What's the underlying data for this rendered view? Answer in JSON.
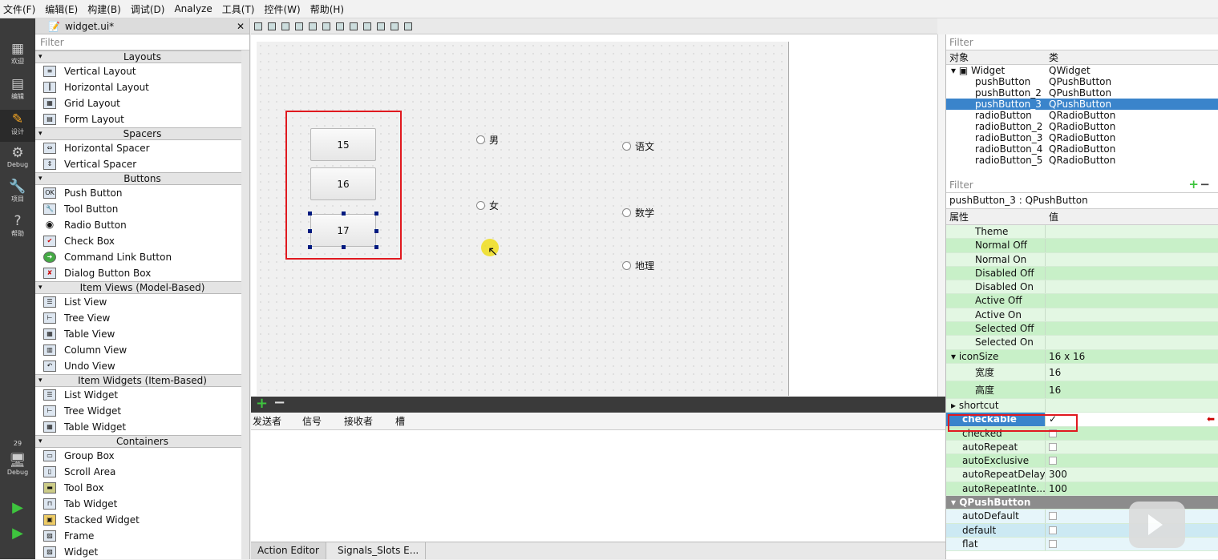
{
  "menu": [
    "文件(F)",
    "编辑(E)",
    "构建(B)",
    "调试(D)",
    "Analyze",
    "工具(T)",
    "控件(W)",
    "帮助(H)"
  ],
  "modes": [
    {
      "label": "欢迎",
      "icon": "▦"
    },
    {
      "label": "编辑",
      "icon": "▤"
    },
    {
      "label": "设计",
      "icon": "✎"
    },
    {
      "label": "Debug",
      "icon": "⚙"
    },
    {
      "label": "项目",
      "icon": "🔧"
    },
    {
      "label": "帮助",
      "icon": "?"
    },
    {
      "label": "29",
      "icon": ""
    },
    {
      "label": "Debug",
      "icon": "🖥"
    }
  ],
  "file_tab": "widget.ui*",
  "widgetbox": {
    "filter_placeholder": "Filter",
    "categories": {
      "layouts": "Layouts",
      "spacers": "Spacers",
      "buttons": "Buttons",
      "item_views": "Item Views (Model-Based)",
      "item_widgets": "Item Widgets (Item-Based)",
      "containers": "Containers"
    },
    "items": {
      "vlayout": "Vertical Layout",
      "hlayout": "Horizontal Layout",
      "grid": "Grid Layout",
      "form": "Form Layout",
      "hspacer": "Horizontal Spacer",
      "vspacer": "Vertical Spacer",
      "push": "Push Button",
      "tool": "Tool Button",
      "radio": "Radio Button",
      "check": "Check Box",
      "cmdlink": "Command Link Button",
      "dialogbox": "Dialog Button Box",
      "listview": "List View",
      "treeview": "Tree View",
      "tableview": "Table View",
      "columnview": "Column View",
      "undoview": "Undo View",
      "listwidget": "List Widget",
      "treewidget": "Tree Widget",
      "tablewidget": "Table Widget",
      "groupbox": "Group Box",
      "scrollarea": "Scroll Area",
      "toolbox": "Tool Box",
      "tabwidget": "Tab Widget",
      "stacked": "Stacked Widget",
      "frame": "Frame",
      "widget": "Widget"
    }
  },
  "form": {
    "buttons": [
      "15",
      "16",
      "17"
    ],
    "radios": {
      "male": "男",
      "female": "女",
      "chinese": "语文",
      "math": "数学",
      "geo": "地理"
    }
  },
  "signals": {
    "headers": [
      "发送者",
      "信号",
      "接收者",
      "槽"
    ]
  },
  "bottom_tabs": [
    "Action Editor",
    "Signals_Slots E..."
  ],
  "objects": {
    "filter_placeholder": "Filter",
    "headers": [
      "对象",
      "类"
    ],
    "root": {
      "name": "Widget",
      "cls": "QWidget"
    },
    "rows": [
      {
        "name": "pushButton",
        "cls": "QPushButton"
      },
      {
        "name": "pushButton_2",
        "cls": "QPushButton"
      },
      {
        "name": "pushButton_3",
        "cls": "QPushButton"
      },
      {
        "name": "radioButton",
        "cls": "QRadioButton"
      },
      {
        "name": "radioButton_2",
        "cls": "QRadioButton"
      },
      {
        "name": "radioButton_3",
        "cls": "QRadioButton"
      },
      {
        "name": "radioButton_4",
        "cls": "QRadioButton"
      },
      {
        "name": "radioButton_5",
        "cls": "QRadioButton"
      }
    ]
  },
  "props": {
    "filter_placeholder": "Filter",
    "title": "pushButton_3 : QPushButton",
    "headers": [
      "属性",
      "值"
    ],
    "rows": [
      {
        "k": "Theme",
        "v": ""
      },
      {
        "k": "Normal Off",
        "v": ""
      },
      {
        "k": "Normal On",
        "v": ""
      },
      {
        "k": "Disabled Off",
        "v": ""
      },
      {
        "k": "Disabled On",
        "v": ""
      },
      {
        "k": "Active Off",
        "v": ""
      },
      {
        "k": "Active On",
        "v": ""
      },
      {
        "k": "Selected Off",
        "v": ""
      },
      {
        "k": "Selected On",
        "v": ""
      },
      {
        "k": "iconSize",
        "v": "16 x 16"
      },
      {
        "k": "宽度",
        "v": "16"
      },
      {
        "k": "高度",
        "v": "16"
      },
      {
        "k": "shortcut",
        "v": ""
      },
      {
        "k": "checkable",
        "v": "✓"
      },
      {
        "k": "checked",
        "v": ""
      },
      {
        "k": "autoRepeat",
        "v": ""
      },
      {
        "k": "autoExclusive",
        "v": ""
      },
      {
        "k": "autoRepeatDelay",
        "v": "300"
      },
      {
        "k": "autoRepeatInte...",
        "v": "100"
      },
      {
        "k": "QPushButton",
        "v": ""
      },
      {
        "k": "autoDefault",
        "v": ""
      },
      {
        "k": "default",
        "v": ""
      },
      {
        "k": "flat",
        "v": ""
      }
    ]
  }
}
